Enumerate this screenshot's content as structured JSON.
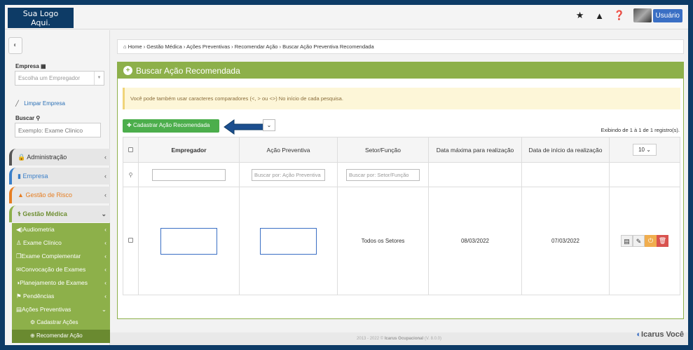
{
  "header": {
    "logo": "Sua Logo\nAqui.",
    "icons": [
      "star-icon",
      "warning-icon",
      "help-icon"
    ],
    "user_label": "Usuário"
  },
  "sidebar": {
    "empresa_label": "Empresa",
    "empresa_placeholder": "Escolha um Empregador",
    "clear_label": "Limpar Empresa",
    "search_label": "Buscar",
    "search_placeholder": "Exemplo: Exame Clinico",
    "menu": [
      {
        "label": "Administração"
      },
      {
        "label": "Empresa"
      },
      {
        "label": "Gestão de Risco"
      },
      {
        "label": "Gestão Médica"
      }
    ],
    "submenu": [
      {
        "label": "Audiometria"
      },
      {
        "label": "Exame Clínico"
      },
      {
        "label": "Exame Complementar"
      },
      {
        "label": "Convocação de Exames"
      },
      {
        "label": "Planejamento de Exames"
      },
      {
        "label": "Pendências"
      },
      {
        "label": "Ações Preventivas"
      }
    ],
    "subsub": [
      {
        "label": "Cadastrar Ações"
      },
      {
        "label": "Recomendar Ação"
      }
    ]
  },
  "breadcrumb": "Home › Gestão Médica › Ações Preventivas › Recomendar Ação › Buscar Ação Preventiva Recomendada",
  "panel": {
    "title": "Buscar Ação Recomendada",
    "alert": "Você pode também usar caracteres comparadores (<, > ou <>) No início de cada pesquisa.",
    "add_button": "Cadastrar Ação Recomendada",
    "info": "Exibindo de 1 à 1 de 1 registro(s).",
    "page_length": "10"
  },
  "table": {
    "headers": [
      "Empregador",
      "Ação Preventiva",
      "Setor/Função",
      "Data máxima para realização",
      "Data de início da realização"
    ],
    "filters": {
      "empregador": "",
      "acao": "Buscar por: Ação Preventiva",
      "setor": "Buscar por: Setor/Função"
    },
    "rows": [
      {
        "empregador": "",
        "acao": "",
        "setor": "Todos os Setores",
        "data_max": "08/03/2022",
        "data_inicio": "07/03/2022"
      }
    ]
  },
  "footer": {
    "text_prefix": "2013 - 2022 ©",
    "app": "Icarus Ocupacional",
    "version": "(V. 8.0.0)",
    "brand": "Icarus Você"
  },
  "colors": {
    "accent": "#8db04a",
    "add_button": "#4cae4c",
    "user_button": "#3a6fc4",
    "frame": "#0d3b66"
  }
}
